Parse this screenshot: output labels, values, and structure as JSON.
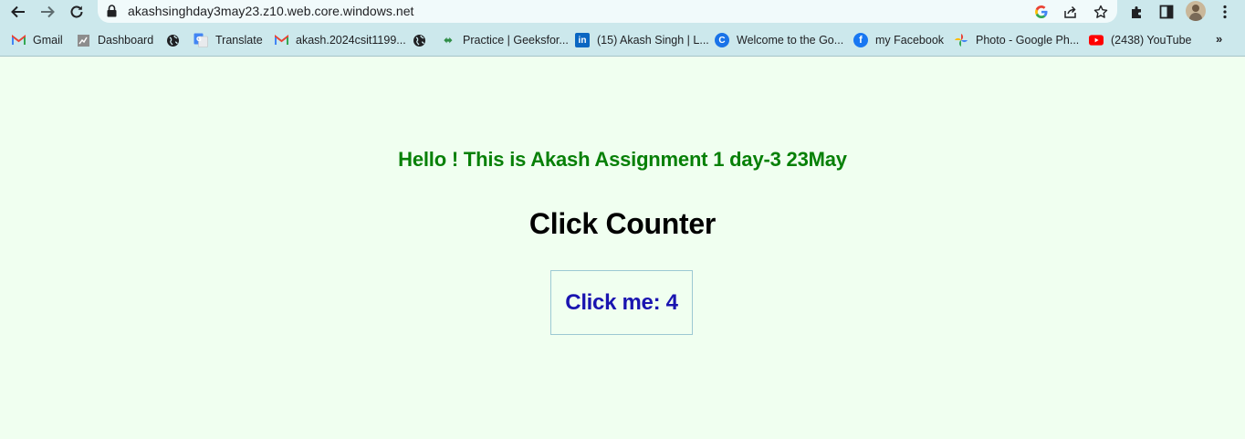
{
  "browser": {
    "url": "akashsinghday3may23.z10.web.core.windows.net",
    "icons": {
      "back": "arrow-left-icon",
      "forward": "arrow-right-icon",
      "reload": "reload-icon",
      "lock": "lock-icon",
      "google": "google-icon",
      "share": "share-icon",
      "bookmark": "star-icon",
      "extensions": "puzzle-icon",
      "side_panel": "side-panel-icon",
      "menu": "kebab-menu-icon"
    }
  },
  "bookmarks": [
    {
      "label": "Gmail",
      "icon": "gmail-icon",
      "color": "#ea4335"
    },
    {
      "label": "Dashboard",
      "icon": "dashboard-icon",
      "color": "#6d6d6d"
    },
    {
      "label": "",
      "icon": "globe-icon",
      "color": "#202124"
    },
    {
      "label": "Translate",
      "icon": "translate-icon",
      "color": "#4285f4"
    },
    {
      "label": "akash.2024csit1199...",
      "icon": "gmail-icon",
      "color": "#ea4335"
    },
    {
      "label": "",
      "icon": "globe-icon",
      "color": "#202124"
    },
    {
      "label": "Practice | Geeksfor...",
      "icon": "geeksforgeeks-icon",
      "color": "#2f8d46"
    },
    {
      "label": "(15) Akash Singh | L...",
      "icon": "linkedin-icon",
      "color": "#0a66c2"
    },
    {
      "label": "Welcome to the Go...",
      "icon": "c-logo-icon",
      "color": "#1a73e8"
    },
    {
      "label": "my Facebook",
      "icon": "facebook-icon",
      "color": "#1877f2"
    },
    {
      "label": "Photo - Google Ph...",
      "icon": "google-photos-icon",
      "color": "#fbbc04"
    },
    {
      "label": "(2438) YouTube",
      "icon": "youtube-icon",
      "color": "#ff0000"
    }
  ],
  "bookmarks_more": "»",
  "page": {
    "greeting": "Hello ! This is Akash Assignment 1 day-3 23May",
    "title": "Click Counter",
    "button_label": "Click me: 4",
    "greeting_color": "#078007",
    "button_text_color": "#1a14b0",
    "background": "#f0fff0"
  }
}
